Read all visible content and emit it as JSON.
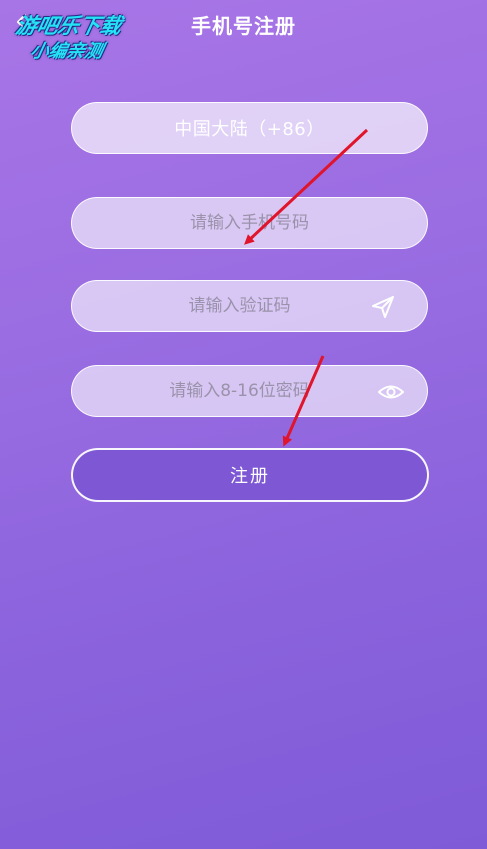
{
  "header": {
    "title": "手机号注册"
  },
  "watermark": {
    "line1": "游吧乐下载",
    "line2": "小编亲测"
  },
  "form": {
    "region": "中国大陆（+86）",
    "phone_placeholder": "请输入手机号码",
    "code_placeholder": "请输入验证码",
    "password_placeholder": "请输入8-16位密码",
    "submit_label": "注册"
  },
  "icons": {
    "back": "back-arrow-icon",
    "send": "paper-plane-icon",
    "visibility": "eye-icon"
  },
  "colors": {
    "background_top": "#a875e6",
    "background_bottom": "#7f5bd8",
    "button_fill": "#7d57d4",
    "annotation_arrow": "#e0142a",
    "watermark_text": "#23e3f5"
  }
}
